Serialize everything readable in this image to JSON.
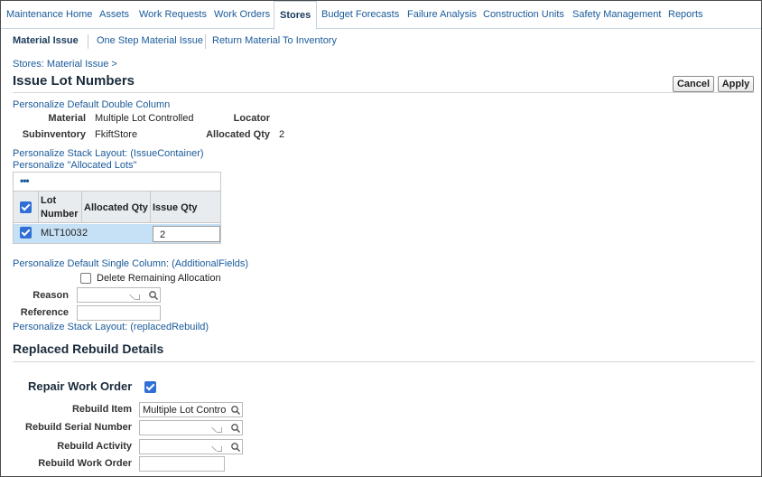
{
  "tabs": [
    {
      "label": "Maintenance Home"
    },
    {
      "label": "Assets"
    },
    {
      "label": "Work Requests"
    },
    {
      "label": "Work Orders"
    },
    {
      "label": "Stores",
      "active": true
    },
    {
      "label": "Budget Forecasts"
    },
    {
      "label": "Failure Analysis"
    },
    {
      "label": "Construction Units"
    },
    {
      "label": "Safety Management"
    },
    {
      "label": "Reports"
    }
  ],
  "subnav": {
    "material_issue": "Material Issue",
    "one_step": "One Step Material Issue",
    "return_material": "Return Material To Inventory"
  },
  "breadcrumb": "Stores: Material Issue  >",
  "page_title": "Issue Lot Numbers",
  "buttons": {
    "cancel": "Cancel",
    "apply": "Apply"
  },
  "personalize": {
    "double_column": "Personalize Default Double Column",
    "stack_issue": "Personalize Stack Layout: (IssueContainer)",
    "allocated_lots": "Personalize \"Allocated Lots\"",
    "single_column": "Personalize Default Single Column: (AdditionalFields)",
    "stack_replaced": "Personalize Stack Layout: (replacedRebuild)"
  },
  "header_fields": {
    "material_label": "Material",
    "material_value": "Multiple Lot Controlled",
    "locator_label": "Locator",
    "subinventory_label": "Subinventory",
    "subinventory_value": "FkiftStore",
    "allocated_qty_label": "Allocated Qty",
    "allocated_qty_value": "2"
  },
  "lots_table": {
    "toolbar_icon": "more-options-icon",
    "columns": [
      "Lot Number",
      "Allocated Qty",
      "Issue Qty"
    ],
    "col_lot_line1": "Lot",
    "col_lot_line2": "Number",
    "rows": [
      {
        "selected": true,
        "lot_number": "MLT1003",
        "allocated_qty": "2",
        "issue_qty": "2"
      }
    ]
  },
  "additional": {
    "delete_remaining": "Delete Remaining Allocation",
    "reason_label": "Reason",
    "reference_label": "Reference"
  },
  "replaced_rebuild": {
    "section_title": "Replaced Rebuild Details",
    "repair_work_order_label": "Repair Work Order",
    "rebuild_item_label": "Rebuild Item",
    "rebuild_item_value": "Multiple Lot Contro",
    "rebuild_serial_label": "Rebuild Serial Number",
    "rebuild_activity_label": "Rebuild Activity",
    "rebuild_work_order_label": "Rebuild Work Order"
  },
  "colors": {
    "link": "#1a5a9a",
    "selected_row": "#c6e0f5",
    "checkbox": "#2f6fd6"
  }
}
